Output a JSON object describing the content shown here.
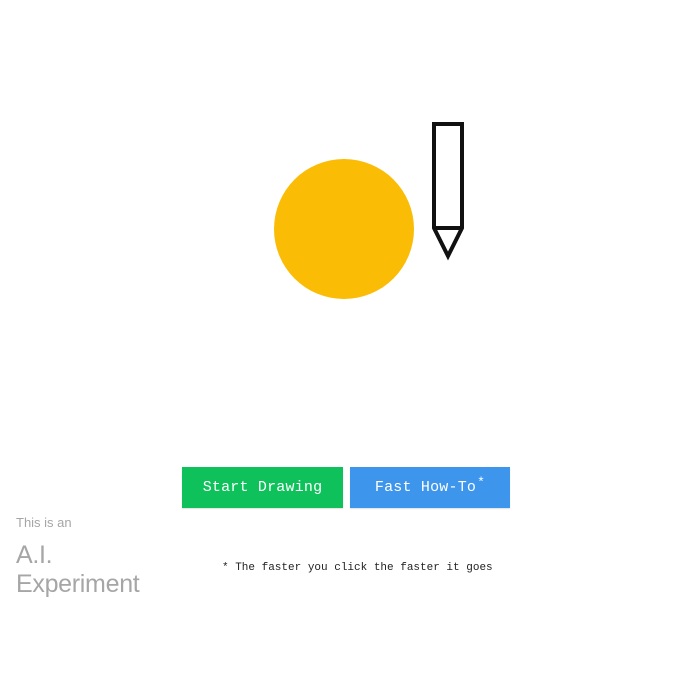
{
  "illustration": {
    "sun_color": "#fbbc05",
    "pencil_icon": "pencil-icon",
    "sun_icon": "circle-shape"
  },
  "actions": {
    "start_label": "Start Drawing",
    "howto_label": "Fast How-To",
    "howto_mark": "*",
    "start_color": "#0fc15a",
    "howto_color": "#3d95ec"
  },
  "note": "* The faster you click the faster it goes",
  "badge": {
    "line1": "This is an",
    "line2": "A.I.",
    "line3": "Experiment"
  }
}
